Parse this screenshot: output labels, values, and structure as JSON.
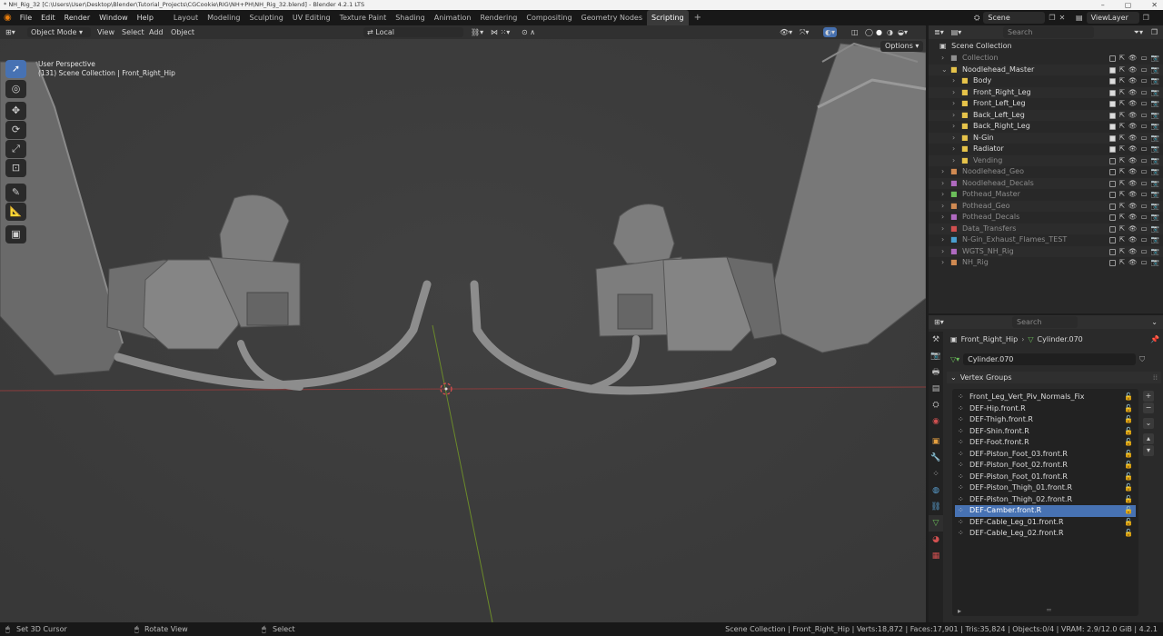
{
  "titlebar": {
    "title": "* NH_Rig_32 [C:\\Users\\User\\Desktop\\Blender\\Tutorial_Projects\\CGCookie\\RIG\\NH+PH\\NH_Rig_32.blend] - Blender 4.2.1 LTS"
  },
  "menubar": {
    "menus": [
      "File",
      "Edit",
      "Render",
      "Window",
      "Help"
    ],
    "workspaces": [
      "Layout",
      "Modeling",
      "Sculpting",
      "UV Editing",
      "Texture Paint",
      "Shading",
      "Animation",
      "Rendering",
      "Compositing",
      "Geometry Nodes",
      "Scripting"
    ],
    "active_workspace": "Scripting",
    "scene": "Scene",
    "view_layer": "ViewLayer"
  },
  "viewport": {
    "mode": "Object Mode",
    "menus": [
      "View",
      "Select",
      "Add",
      "Object"
    ],
    "transform_orientation": "Local",
    "options_label": "Options",
    "overlay_line1": "User Perspective",
    "overlay_line2": "(131) Scene Collection | Front_Right_Hip"
  },
  "outliner": {
    "search_placeholder": "Search",
    "root": "Scene Collection",
    "items": [
      {
        "label": "Collection",
        "indent": 0,
        "dim": true,
        "color": "#8f8f8f"
      },
      {
        "label": "Noodlehead_Master",
        "indent": 0,
        "dim": false,
        "color": "#e6c34a"
      },
      {
        "label": "Body",
        "indent": 1,
        "dim": false,
        "color": "#e6c34a"
      },
      {
        "label": "Front_Right_Leg",
        "indent": 1,
        "dim": false,
        "color": "#e6c34a"
      },
      {
        "label": "Front_Left_Leg",
        "indent": 1,
        "dim": false,
        "color": "#e6c34a"
      },
      {
        "label": "Back_Left_Leg",
        "indent": 1,
        "dim": false,
        "color": "#e6c34a"
      },
      {
        "label": "Back_Right_Leg",
        "indent": 1,
        "dim": false,
        "color": "#e6c34a"
      },
      {
        "label": "N-Gin",
        "indent": 1,
        "dim": false,
        "color": "#e6c34a"
      },
      {
        "label": "Radiator",
        "indent": 1,
        "dim": false,
        "color": "#e6c34a"
      },
      {
        "label": "Vending",
        "indent": 1,
        "dim": true,
        "color": "#e6c34a"
      },
      {
        "label": "Noodlehead_Geo",
        "indent": 0,
        "dim": true,
        "color": "#d08a52"
      },
      {
        "label": "Noodlehead_Decals",
        "indent": 0,
        "dim": true,
        "color": "#b06ac0"
      },
      {
        "label": "Pothead_Master",
        "indent": 0,
        "dim": true,
        "color": "#6bbf5a"
      },
      {
        "label": "Pothead_Geo",
        "indent": 0,
        "dim": true,
        "color": "#d08a52"
      },
      {
        "label": "Pothead_Decals",
        "indent": 0,
        "dim": true,
        "color": "#b06ac0"
      },
      {
        "label": "Data_Transfers",
        "indent": 0,
        "dim": true,
        "color": "#d05050"
      },
      {
        "label": "N-Gin_Exhaust_Flames_TEST",
        "indent": 0,
        "dim": true,
        "color": "#4a9fd0"
      },
      {
        "label": "WGTS_NH_Rig",
        "indent": 0,
        "dim": true,
        "color": "#b06ac0"
      },
      {
        "label": "NH_Rig",
        "indent": 0,
        "dim": true,
        "color": "#d08a52"
      }
    ]
  },
  "properties": {
    "search_placeholder": "Search",
    "breadcrumb_object": "Front_Right_Hip",
    "breadcrumb_mesh": "Cylinder.070",
    "mesh_name": "Cylinder.070",
    "panel_title": "Vertex Groups",
    "vertex_groups": [
      "Front_Leg_Vert_Piv_Normals_Fix",
      "DEF-Hip.front.R",
      "DEF-Thigh.front.R",
      "DEF-Shin.front.R",
      "DEF-Foot.front.R",
      "DEF-Piston_Foot_03.front.R",
      "DEF-Piston_Foot_02.front.R",
      "DEF-Piston_Foot_01.front.R",
      "DEF-Piston_Thigh_01.front.R",
      "DEF-Piston_Thigh_02.front.R",
      "DEF-Camber.front.R",
      "DEF-Cable_Leg_01.front.R",
      "DEF-Cable_Leg_02.front.R"
    ],
    "selected_group": "DEF-Camber.front.R"
  },
  "statusbar": {
    "hint1": "Set 3D Cursor",
    "hint2": "Rotate View",
    "hint3": "Select",
    "stats": "Scene Collection | Front_Right_Hip | Verts:18,872 | Faces:17,901 | Tris:35,824 | Objects:0/4 | VRAM: 2.9/12.0 GiB | 4.2.1"
  },
  "colors": {
    "accent": "#4772b3",
    "viewport_bg": "#3c3c3c",
    "panel_bg": "#2a2a2a",
    "collection_yellow": "#e6c34a"
  }
}
